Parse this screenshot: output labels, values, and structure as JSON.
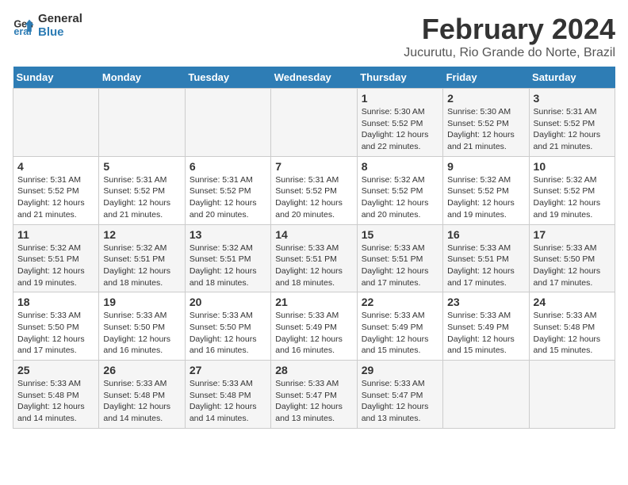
{
  "logo": {
    "text_general": "General",
    "text_blue": "Blue"
  },
  "header": {
    "title": "February 2024",
    "subtitle": "Jucurutu, Rio Grande do Norte, Brazil"
  },
  "days_of_week": [
    "Sunday",
    "Monday",
    "Tuesday",
    "Wednesday",
    "Thursday",
    "Friday",
    "Saturday"
  ],
  "weeks": [
    [
      {
        "day": "",
        "info": ""
      },
      {
        "day": "",
        "info": ""
      },
      {
        "day": "",
        "info": ""
      },
      {
        "day": "",
        "info": ""
      },
      {
        "day": "1",
        "info": "Sunrise: 5:30 AM\nSunset: 5:52 PM\nDaylight: 12 hours\nand 22 minutes."
      },
      {
        "day": "2",
        "info": "Sunrise: 5:30 AM\nSunset: 5:52 PM\nDaylight: 12 hours\nand 21 minutes."
      },
      {
        "day": "3",
        "info": "Sunrise: 5:31 AM\nSunset: 5:52 PM\nDaylight: 12 hours\nand 21 minutes."
      }
    ],
    [
      {
        "day": "4",
        "info": "Sunrise: 5:31 AM\nSunset: 5:52 PM\nDaylight: 12 hours\nand 21 minutes."
      },
      {
        "day": "5",
        "info": "Sunrise: 5:31 AM\nSunset: 5:52 PM\nDaylight: 12 hours\nand 21 minutes."
      },
      {
        "day": "6",
        "info": "Sunrise: 5:31 AM\nSunset: 5:52 PM\nDaylight: 12 hours\nand 20 minutes."
      },
      {
        "day": "7",
        "info": "Sunrise: 5:31 AM\nSunset: 5:52 PM\nDaylight: 12 hours\nand 20 minutes."
      },
      {
        "day": "8",
        "info": "Sunrise: 5:32 AM\nSunset: 5:52 PM\nDaylight: 12 hours\nand 20 minutes."
      },
      {
        "day": "9",
        "info": "Sunrise: 5:32 AM\nSunset: 5:52 PM\nDaylight: 12 hours\nand 19 minutes."
      },
      {
        "day": "10",
        "info": "Sunrise: 5:32 AM\nSunset: 5:52 PM\nDaylight: 12 hours\nand 19 minutes."
      }
    ],
    [
      {
        "day": "11",
        "info": "Sunrise: 5:32 AM\nSunset: 5:51 PM\nDaylight: 12 hours\nand 19 minutes."
      },
      {
        "day": "12",
        "info": "Sunrise: 5:32 AM\nSunset: 5:51 PM\nDaylight: 12 hours\nand 18 minutes."
      },
      {
        "day": "13",
        "info": "Sunrise: 5:32 AM\nSunset: 5:51 PM\nDaylight: 12 hours\nand 18 minutes."
      },
      {
        "day": "14",
        "info": "Sunrise: 5:33 AM\nSunset: 5:51 PM\nDaylight: 12 hours\nand 18 minutes."
      },
      {
        "day": "15",
        "info": "Sunrise: 5:33 AM\nSunset: 5:51 PM\nDaylight: 12 hours\nand 17 minutes."
      },
      {
        "day": "16",
        "info": "Sunrise: 5:33 AM\nSunset: 5:51 PM\nDaylight: 12 hours\nand 17 minutes."
      },
      {
        "day": "17",
        "info": "Sunrise: 5:33 AM\nSunset: 5:50 PM\nDaylight: 12 hours\nand 17 minutes."
      }
    ],
    [
      {
        "day": "18",
        "info": "Sunrise: 5:33 AM\nSunset: 5:50 PM\nDaylight: 12 hours\nand 17 minutes."
      },
      {
        "day": "19",
        "info": "Sunrise: 5:33 AM\nSunset: 5:50 PM\nDaylight: 12 hours\nand 16 minutes."
      },
      {
        "day": "20",
        "info": "Sunrise: 5:33 AM\nSunset: 5:50 PM\nDaylight: 12 hours\nand 16 minutes."
      },
      {
        "day": "21",
        "info": "Sunrise: 5:33 AM\nSunset: 5:49 PM\nDaylight: 12 hours\nand 16 minutes."
      },
      {
        "day": "22",
        "info": "Sunrise: 5:33 AM\nSunset: 5:49 PM\nDaylight: 12 hours\nand 15 minutes."
      },
      {
        "day": "23",
        "info": "Sunrise: 5:33 AM\nSunset: 5:49 PM\nDaylight: 12 hours\nand 15 minutes."
      },
      {
        "day": "24",
        "info": "Sunrise: 5:33 AM\nSunset: 5:48 PM\nDaylight: 12 hours\nand 15 minutes."
      }
    ],
    [
      {
        "day": "25",
        "info": "Sunrise: 5:33 AM\nSunset: 5:48 PM\nDaylight: 12 hours\nand 14 minutes."
      },
      {
        "day": "26",
        "info": "Sunrise: 5:33 AM\nSunset: 5:48 PM\nDaylight: 12 hours\nand 14 minutes."
      },
      {
        "day": "27",
        "info": "Sunrise: 5:33 AM\nSunset: 5:48 PM\nDaylight: 12 hours\nand 14 minutes."
      },
      {
        "day": "28",
        "info": "Sunrise: 5:33 AM\nSunset: 5:47 PM\nDaylight: 12 hours\nand 13 minutes."
      },
      {
        "day": "29",
        "info": "Sunrise: 5:33 AM\nSunset: 5:47 PM\nDaylight: 12 hours\nand 13 minutes."
      },
      {
        "day": "",
        "info": ""
      },
      {
        "day": "",
        "info": ""
      }
    ]
  ]
}
